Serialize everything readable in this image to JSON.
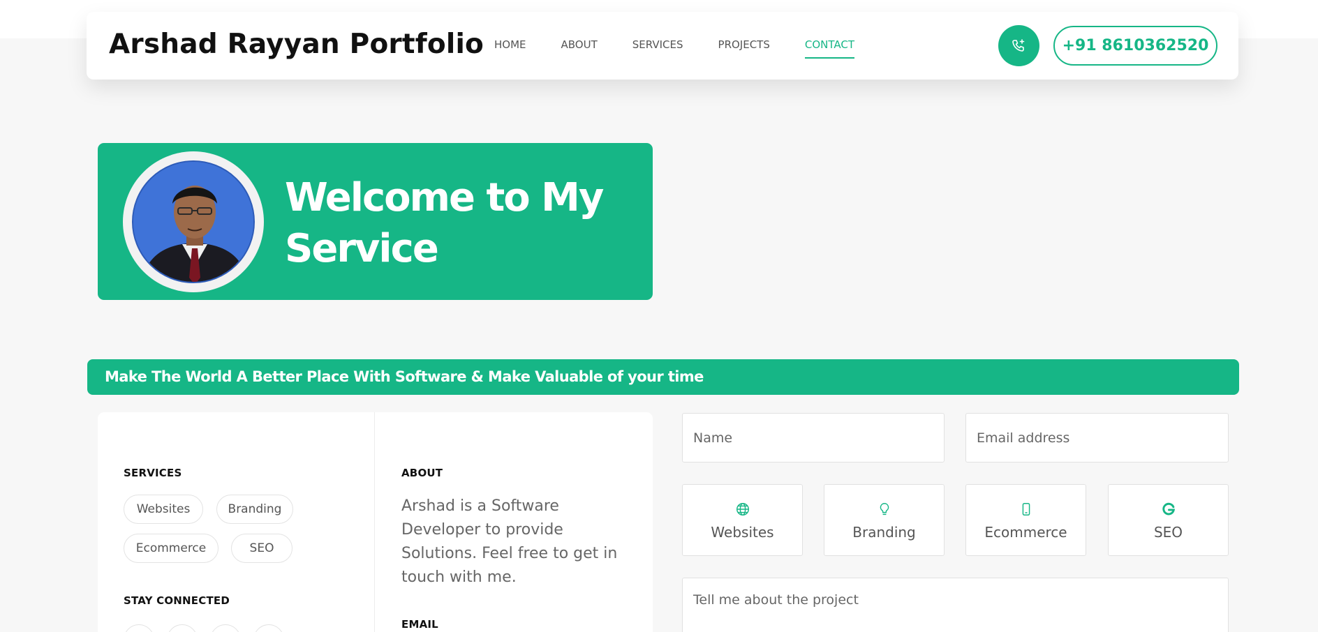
{
  "header": {
    "brand": "Arshad Rayyan Portfolio",
    "nav": [
      {
        "label": "HOME",
        "active": false
      },
      {
        "label": "ABOUT",
        "active": false
      },
      {
        "label": "SERVICES",
        "active": false
      },
      {
        "label": "PROJECTS",
        "active": false
      },
      {
        "label": "CONTACT",
        "active": true
      }
    ],
    "phone_icon": "phone-plus-icon",
    "phone_number": "+91 8610362520"
  },
  "hero": {
    "title": "Welcome to My Service",
    "avatar": "profile-photo"
  },
  "banner": {
    "text": "Make The World A Better Place With Software & Make Valuable of your time"
  },
  "info": {
    "services_label": "SERVICES",
    "service_tags": [
      "Websites",
      "Branding",
      "Ecommerce",
      "SEO"
    ],
    "stay_connected_label": "STAY CONNECTED",
    "about_label": "ABOUT",
    "about_text": "Arshad is a Software Developer to provide Solutions. Feel free to get in touch with me.",
    "email_label": "EMAIL"
  },
  "form": {
    "name_placeholder": "Name",
    "email_placeholder": "Email address",
    "services": [
      {
        "label": "Websites",
        "icon": "globe-icon"
      },
      {
        "label": "Branding",
        "icon": "lightbulb-icon"
      },
      {
        "label": "Ecommerce",
        "icon": "mobile-icon"
      },
      {
        "label": "SEO",
        "icon": "google-icon"
      }
    ],
    "project_placeholder": "Tell me about the project"
  },
  "colors": {
    "accent": "#16b686",
    "page_bg": "#f7f7f7"
  }
}
